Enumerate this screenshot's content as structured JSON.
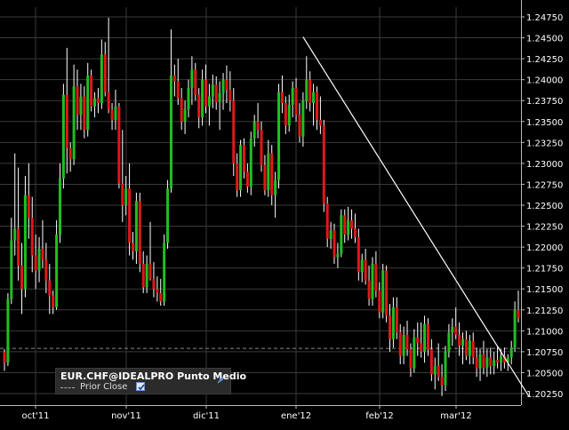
{
  "chart_data": {
    "type": "candlestick",
    "instrument_label": "EUR.CHF@IDEALPRO Punto Medio",
    "y_axis": {
      "position": "right",
      "ylim": [
        1.2,
        1.249
      ],
      "ticks": [
        "1.24750",
        "1.24500",
        "1.24250",
        "1.24000",
        "1.23750",
        "1.23500",
        "1.23250",
        "1.23000",
        "1.22750",
        "1.22500",
        "1.22250",
        "1.22000",
        "1.21750",
        "1.21500",
        "1.21250",
        "1.21000",
        "1.20750",
        "1.20500",
        "1.20250"
      ]
    },
    "x_axis": {
      "tick_labels": [
        "oct'11",
        "nov'11",
        "dic'11",
        "ene'12",
        "feb'12",
        "mar'12"
      ]
    },
    "colors": {
      "up": "#1fbf1f",
      "down": "#e01818",
      "wick": "#ffffff",
      "grid": "#3a3a3a",
      "background": "#000000",
      "trendline": "#ffffff"
    },
    "grid": true,
    "prior_close": 1.2079,
    "trendline": {
      "start": {
        "bar": 86,
        "price": 1.2451
      },
      "end": {
        "bar": 151,
        "price": 1.2022
      }
    },
    "candles": [
      [
        1.2075,
        1.2078,
        1.2052,
        1.2062
      ],
      [
        1.2062,
        1.2145,
        1.2058,
        1.2138
      ],
      [
        1.2138,
        1.2235,
        1.2132,
        1.2208
      ],
      [
        1.2208,
        1.2312,
        1.219,
        1.2222
      ],
      [
        1.2222,
        1.2295,
        1.216,
        1.2178
      ],
      [
        1.2178,
        1.2205,
        1.212,
        1.215
      ],
      [
        1.215,
        1.2285,
        1.214,
        1.2262
      ],
      [
        1.2262,
        1.23,
        1.221,
        1.2235
      ],
      [
        1.2235,
        1.226,
        1.217,
        1.219
      ],
      [
        1.219,
        1.2215,
        1.215,
        1.2172
      ],
      [
        1.2172,
        1.2212,
        1.2158,
        1.2198
      ],
      [
        1.2198,
        1.2232,
        1.2175,
        1.2185
      ],
      [
        1.2185,
        1.2205,
        1.2145,
        1.216
      ],
      [
        1.216,
        1.218,
        1.212,
        1.2142
      ],
      [
        1.2142,
        1.2148,
        1.212,
        1.2128
      ],
      [
        1.2128,
        1.2232,
        1.2125,
        1.2215
      ],
      [
        1.2215,
        1.23,
        1.2205,
        1.2282
      ],
      [
        1.2282,
        1.2395,
        1.227,
        1.2382
      ],
      [
        1.2382,
        1.2438,
        1.2288,
        1.2318
      ],
      [
        1.2318,
        1.2325,
        1.229,
        1.2305
      ],
      [
        1.2305,
        1.2418,
        1.2298,
        1.2392
      ],
      [
        1.2392,
        1.2412,
        1.234,
        1.2358
      ],
      [
        1.2358,
        1.2395,
        1.234,
        1.238
      ],
      [
        1.238,
        1.2392,
        1.233,
        1.234
      ],
      [
        1.234,
        1.242,
        1.2332,
        1.2405
      ],
      [
        1.2405,
        1.2412,
        1.2362,
        1.2368
      ],
      [
        1.2368,
        1.2385,
        1.2355,
        1.2378
      ],
      [
        1.2378,
        1.239,
        1.236,
        1.2372
      ],
      [
        1.2372,
        1.2448,
        1.2365,
        1.243
      ],
      [
        1.243,
        1.2445,
        1.238,
        1.2385
      ],
      [
        1.2385,
        1.2474,
        1.236,
        1.2364
      ],
      [
        1.2364,
        1.2372,
        1.234,
        1.2352
      ],
      [
        1.2352,
        1.2388,
        1.234,
        1.2368
      ],
      [
        1.2368,
        1.2372,
        1.227,
        1.2276
      ],
      [
        1.2276,
        1.234,
        1.223,
        1.225
      ],
      [
        1.225,
        1.2285,
        1.2238,
        1.227
      ],
      [
        1.227,
        1.23,
        1.219,
        1.2205
      ],
      [
        1.2205,
        1.2218,
        1.2185,
        1.2195
      ],
      [
        1.2195,
        1.2265,
        1.218,
        1.2255
      ],
      [
        1.2255,
        1.2265,
        1.217,
        1.218
      ],
      [
        1.218,
        1.2195,
        1.2145,
        1.2152
      ],
      [
        1.2152,
        1.219,
        1.2145,
        1.218
      ],
      [
        1.218,
        1.223,
        1.216,
        1.2162
      ],
      [
        1.2162,
        1.2182,
        1.214,
        1.215
      ],
      [
        1.215,
        1.2165,
        1.2135,
        1.2145
      ],
      [
        1.2145,
        1.2162,
        1.213,
        1.2135
      ],
      [
        1.2135,
        1.2215,
        1.213,
        1.2205
      ],
      [
        1.2205,
        1.228,
        1.2198,
        1.227
      ],
      [
        1.227,
        1.246,
        1.2265,
        1.2405
      ],
      [
        1.2405,
        1.2418,
        1.238,
        1.2398
      ],
      [
        1.2398,
        1.2425,
        1.237,
        1.2378
      ],
      [
        1.2378,
        1.239,
        1.234,
        1.235
      ],
      [
        1.235,
        1.2375,
        1.2335,
        1.2365
      ],
      [
        1.2365,
        1.24,
        1.2355,
        1.239
      ],
      [
        1.239,
        1.2428,
        1.237,
        1.2412
      ],
      [
        1.2412,
        1.242,
        1.2375,
        1.2382
      ],
      [
        1.2382,
        1.239,
        1.2342,
        1.2355
      ],
      [
        1.2355,
        1.2412,
        1.2345,
        1.24
      ],
      [
        1.24,
        1.2418,
        1.236,
        1.2368
      ],
      [
        1.2368,
        1.2395,
        1.2345,
        1.238
      ],
      [
        1.238,
        1.2406,
        1.2366,
        1.2394
      ],
      [
        1.2394,
        1.2404,
        1.2364,
        1.2373
      ],
      [
        1.2373,
        1.2398,
        1.234,
        1.2384
      ],
      [
        1.2384,
        1.2408,
        1.2364,
        1.24
      ],
      [
        1.24,
        1.2417,
        1.2372,
        1.2388
      ],
      [
        1.2388,
        1.241,
        1.2362,
        1.2375
      ],
      [
        1.2375,
        1.239,
        1.2285,
        1.23
      ],
      [
        1.23,
        1.2312,
        1.226,
        1.2268
      ],
      [
        1.2268,
        1.2328,
        1.226,
        1.2322
      ],
      [
        1.2322,
        1.233,
        1.2282,
        1.229
      ],
      [
        1.229,
        1.23,
        1.2265,
        1.2272
      ],
      [
        1.2272,
        1.2338,
        1.2262,
        1.233
      ],
      [
        1.233,
        1.2358,
        1.232,
        1.235
      ],
      [
        1.235,
        1.2372,
        1.233,
        1.234
      ],
      [
        1.234,
        1.235,
        1.229,
        1.2298
      ],
      [
        1.2298,
        1.231,
        1.2262,
        1.2268
      ],
      [
        1.2268,
        1.2328,
        1.226,
        1.2312
      ],
      [
        1.2312,
        1.2322,
        1.225,
        1.2262
      ],
      [
        1.2262,
        1.229,
        1.2235,
        1.228
      ],
      [
        1.228,
        1.2395,
        1.227,
        1.2385
      ],
      [
        1.2385,
        1.2405,
        1.236,
        1.2372
      ],
      [
        1.2372,
        1.238,
        1.2335,
        1.2345
      ],
      [
        1.2345,
        1.2382,
        1.2338,
        1.237
      ],
      [
        1.237,
        1.2398,
        1.2355,
        1.239
      ],
      [
        1.239,
        1.2402,
        1.235,
        1.2358
      ],
      [
        1.2358,
        1.2372,
        1.2325,
        1.2332
      ],
      [
        1.2332,
        1.2385,
        1.232,
        1.2375
      ],
      [
        1.2375,
        1.2428,
        1.2365,
        1.24
      ],
      [
        1.24,
        1.241,
        1.2362,
        1.2372
      ],
      [
        1.2372,
        1.2395,
        1.2345,
        1.2385
      ],
      [
        1.2385,
        1.2392,
        1.234,
        1.2352
      ],
      [
        1.2352,
        1.238,
        1.2335,
        1.2345
      ],
      [
        1.2345,
        1.2352,
        1.2242,
        1.2252
      ],
      [
        1.2252,
        1.226,
        1.22,
        1.221
      ],
      [
        1.221,
        1.223,
        1.2198,
        1.222
      ],
      [
        1.222,
        1.2228,
        1.218,
        1.2188
      ],
      [
        1.2188,
        1.2205,
        1.2175,
        1.2192
      ],
      [
        1.2192,
        1.2245,
        1.2188,
        1.2238
      ],
      [
        1.2238,
        1.2245,
        1.2205,
        1.2215
      ],
      [
        1.2215,
        1.2248,
        1.2208,
        1.2232
      ],
      [
        1.2232,
        1.2245,
        1.221,
        1.2222
      ],
      [
        1.2222,
        1.224,
        1.2205,
        1.2212
      ],
      [
        1.2212,
        1.2222,
        1.216,
        1.217
      ],
      [
        1.217,
        1.2192,
        1.2158,
        1.2185
      ],
      [
        1.2185,
        1.2198,
        1.2155,
        1.216
      ],
      [
        1.216,
        1.2178,
        1.213,
        1.2138
      ],
      [
        1.2138,
        1.2188,
        1.213,
        1.218
      ],
      [
        1.218,
        1.2195,
        1.214,
        1.2148
      ],
      [
        1.2148,
        1.2158,
        1.2115,
        1.2122
      ],
      [
        1.2122,
        1.218,
        1.2115,
        1.2172
      ],
      [
        1.2172,
        1.2178,
        1.211,
        1.2118
      ],
      [
        1.2118,
        1.2132,
        1.2075,
        1.209
      ],
      [
        1.209,
        1.214,
        1.208,
        1.2128
      ],
      [
        1.2128,
        1.214,
        1.209,
        1.2098
      ],
      [
        1.2098,
        1.2108,
        1.206,
        1.207
      ],
      [
        1.207,
        1.2105,
        1.206,
        1.2095
      ],
      [
        1.2095,
        1.2112,
        1.207,
        1.2078
      ],
      [
        1.2078,
        1.2085,
        1.2045,
        1.2055
      ],
      [
        1.2055,
        1.2102,
        1.205,
        1.2092
      ],
      [
        1.2092,
        1.211,
        1.207,
        1.2085
      ],
      [
        1.2085,
        1.211,
        1.2068,
        1.2075
      ],
      [
        1.2075,
        1.2118,
        1.2062,
        1.2108
      ],
      [
        1.2108,
        1.2115,
        1.207,
        1.2078
      ],
      [
        1.2078,
        1.209,
        1.204,
        1.2048
      ],
      [
        1.2048,
        1.2068,
        1.203,
        1.2058
      ],
      [
        1.2058,
        1.2085,
        1.204,
        1.2045
      ],
      [
        1.2045,
        1.206,
        1.2022,
        1.2035
      ],
      [
        1.2035,
        1.2082,
        1.2028,
        1.2075
      ],
      [
        1.2075,
        1.2108,
        1.2068,
        1.2098
      ],
      [
        1.2098,
        1.2115,
        1.2082,
        1.2105
      ],
      [
        1.2105,
        1.2128,
        1.209,
        1.2095
      ],
      [
        1.2095,
        1.211,
        1.207,
        1.2082
      ],
      [
        1.2082,
        1.2098,
        1.206,
        1.209
      ],
      [
        1.209,
        1.21,
        1.2065,
        1.207
      ],
      [
        1.207,
        1.2095,
        1.206,
        1.2088
      ],
      [
        1.2088,
        1.2098,
        1.206,
        1.2068
      ],
      [
        1.2068,
        1.208,
        1.2045,
        1.2055
      ],
      [
        1.2055,
        1.2078,
        1.204,
        1.2072
      ],
      [
        1.2072,
        1.2088,
        1.2048,
        1.2056
      ],
      [
        1.2056,
        1.2078,
        1.2045,
        1.2068
      ],
      [
        1.2068,
        1.208,
        1.2048,
        1.2058
      ],
      [
        1.2058,
        1.2075,
        1.2048,
        1.2065
      ],
      [
        1.2065,
        1.2082,
        1.2055,
        1.2062
      ],
      [
        1.2062,
        1.2078,
        1.2052,
        1.207
      ],
      [
        1.207,
        1.208,
        1.2055,
        1.2062
      ],
      [
        1.2062,
        1.2072,
        1.2052,
        1.2068
      ],
      [
        1.2068,
        1.2088,
        1.206,
        1.208
      ],
      [
        1.208,
        1.2135,
        1.2075,
        1.2125
      ],
      [
        1.2125,
        1.2148,
        1.211,
        1.2115
      ]
    ]
  },
  "legend": {
    "title": "EUR.CHF@IDEALPRO Punto Medio",
    "prior_close_label": "Prior Close",
    "prior_close_checked": true,
    "pin_icon": "pin-icon"
  }
}
